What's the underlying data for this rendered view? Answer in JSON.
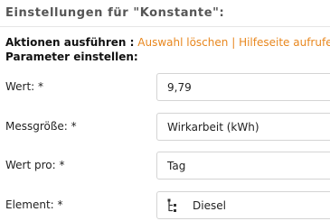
{
  "section": {
    "title": "Einstellungen für \"Konstante\":"
  },
  "actions": {
    "label": "Aktionen ausführen :",
    "clear_selection": "Auswahl löschen",
    "separator": "|",
    "help_page": "Hilfeseite aufrufen"
  },
  "parameters": {
    "heading": "Parameter einstellen:"
  },
  "fields": [
    {
      "label": "Wert: *",
      "value": "9,79"
    },
    {
      "label": "Messgröße: *",
      "value": "Wirkarbeit (kWh)"
    },
    {
      "label": "Wert pro: *",
      "value": "Tag"
    },
    {
      "label": "Element: *",
      "value": "Diesel",
      "icon": "tree-structure-icon"
    }
  ],
  "colors": {
    "link": "#e8871e",
    "heading": "#555555",
    "field_border": "#d4d4d4"
  }
}
